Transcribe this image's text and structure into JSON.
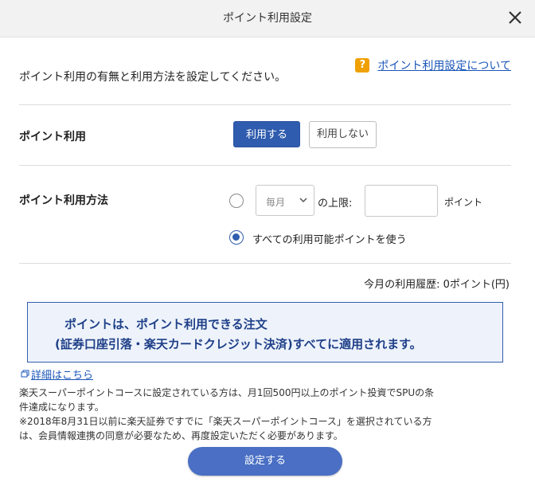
{
  "header": {
    "title": "ポイント利用設定"
  },
  "intro": {
    "text": "ポイント利用の有無と利用方法を設定してください。",
    "help_link": "ポイント利用設定について",
    "help_icon_text": "?"
  },
  "usage": {
    "label": "ポイント利用",
    "use_label": "利用する",
    "nouse_label": "利用しない",
    "selected": "use"
  },
  "method": {
    "label": "ポイント利用方法",
    "monthly_value": "毎月",
    "limit_label": "の上限:",
    "limit_value": "",
    "unit": "ポイント",
    "all_label": "すべての利用可能ポイントを使う",
    "selected": "all"
  },
  "history": {
    "text": "今月の利用履歴: 0ポイント(円)"
  },
  "notice": {
    "line1": "ポイントは、ポイント利用できる注文",
    "line2": "(証券口座引落・楽天カードクレジット決済)すべてに適用されます。"
  },
  "detail_link": "詳細はこちら",
  "notes": {
    "line1": "楽天スーパーポイントコースに設定されている方は、月1回500円以上のポイント投資でSPUの条",
    "line2": "件達成になります。",
    "line3": "※2018年8月31日以前に楽天証券ですでに「楽天スーパーポイントコース」を選択されている方",
    "line4": "は、会員情報連携の同意が必要なため、再度設定いただく必要があります。"
  },
  "submit_label": "設定する",
  "colors": {
    "accent": "#2f5cae",
    "link": "#1a55b8",
    "help": "#f0a000"
  }
}
